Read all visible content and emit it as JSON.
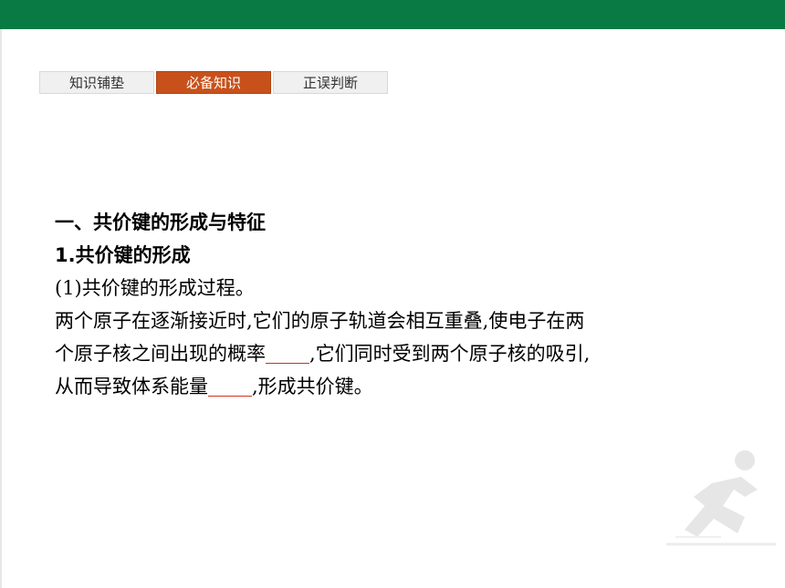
{
  "tabs": [
    {
      "label": "知识铺垫",
      "active": false
    },
    {
      "label": "必备知识",
      "active": true
    },
    {
      "label": "正误判断",
      "active": false
    }
  ],
  "content": {
    "section_title": "一、共价键的形成与特征",
    "subsection_num": "1",
    "subsection_title": ".共价键的形成",
    "item_label": "(1)共价键的形成过程。",
    "line1": "两个原子在逐渐接近时,它们的原子轨道会相互重叠,使电子在两",
    "line2_a": "个原子核之间出现的概率",
    "line2_b": ",它们同时受到两个原子核的吸引,",
    "line3_a": "从而导致体系能量",
    "line3_b": ",形成共价键。"
  },
  "colors": {
    "top_bar": "#0a7a45",
    "active_tab": "#c8511b",
    "blank_underline": "#d0301c"
  },
  "icons": {
    "decor": "runner-silhouette-icon"
  }
}
